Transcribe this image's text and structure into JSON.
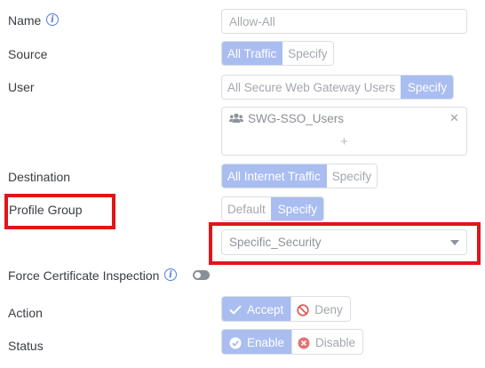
{
  "name": {
    "label": "Name",
    "value": "Allow-All"
  },
  "source": {
    "label": "Source",
    "options": [
      "All Traffic",
      "Specify"
    ],
    "selected": "All Traffic"
  },
  "user": {
    "label": "User",
    "options": [
      "All Secure Web Gateway Users",
      "Specify"
    ],
    "selected": "Specify",
    "chip": "SWG-SSO_Users",
    "add_symbol": "+",
    "remove_symbol": "✕"
  },
  "destination": {
    "label": "Destination",
    "options": [
      "All Internet Traffic",
      "Specify"
    ],
    "selected": "All Internet Traffic"
  },
  "profile_group": {
    "label": "Profile Group",
    "options": [
      "Default",
      "Specify"
    ],
    "selected": "Specify",
    "dropdown_value": "Specific_Security"
  },
  "force_cert": {
    "label": "Force Certificate Inspection",
    "enabled": false
  },
  "action": {
    "label": "Action",
    "accept_label": "Accept",
    "deny_label": "Deny",
    "selected": "Accept"
  },
  "status": {
    "label": "Status",
    "enable_label": "Enable",
    "disable_label": "Disable",
    "selected": "Enable"
  },
  "icons": {
    "info": "info-icon",
    "users": "users-icon",
    "remove": "close-icon",
    "add": "plus-icon",
    "dropdown": "caret-down-icon",
    "check": "check-icon",
    "deny": "ban-icon",
    "enable": "check-circle-icon",
    "disable": "x-circle-icon"
  },
  "colors": {
    "accent": "#a9bdf0",
    "highlight_box": "#e0151b",
    "info_icon": "#4f7ee0",
    "deny_icon": "#d9534f"
  }
}
